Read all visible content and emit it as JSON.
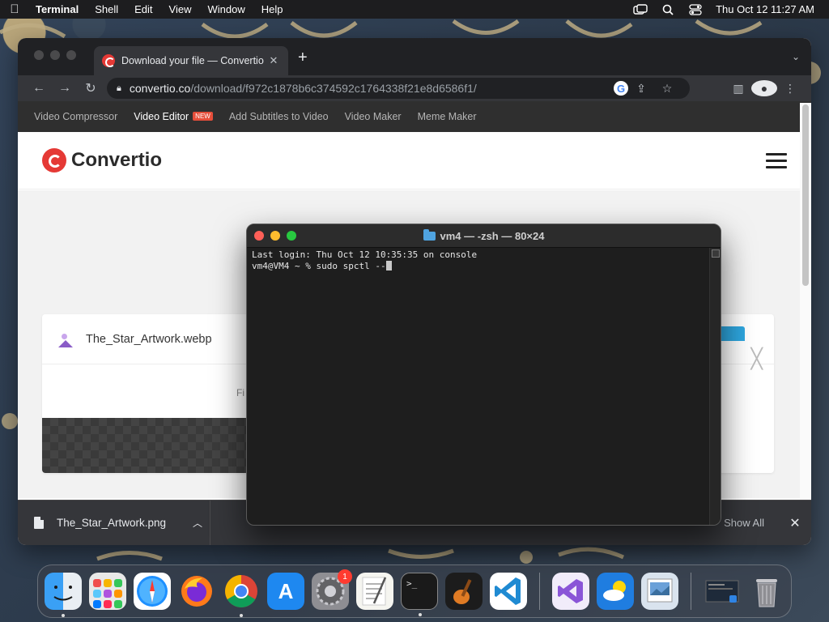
{
  "menubar": {
    "app_name": "Terminal",
    "items": [
      "Shell",
      "Edit",
      "View",
      "Window",
      "Help"
    ],
    "clock": "Thu Oct 12  11:27 AM"
  },
  "browser": {
    "tab_title": "Download your file — Convertio",
    "url_host": "convertio.co",
    "url_path": "/download/f972c1878b6c374592c1764338f21e8d6586f1/",
    "site_nav": {
      "items": [
        "Video Compressor",
        "Video Editor",
        "Add Subtitles to Video",
        "Video Maker",
        "Meme Maker"
      ],
      "badge": "NEW"
    },
    "logo_text": "Convertio",
    "file_name": "The_Star_Artwork.webp",
    "file_sub": "Fi",
    "download_shelf": {
      "file": "The_Star_Artwork.png",
      "show_all": "Show All"
    }
  },
  "terminal": {
    "title": "vm4 — -zsh — 80×24",
    "line1": "Last login: Thu Oct 12 10:35:35 on console",
    "line2": "vm4@VM4 ~ % sudo spctl --"
  },
  "dock": {
    "settings_badge": "1"
  },
  "colors": {
    "menubar": "#1d1d1f",
    "terminal_bg": "#1e1e1e",
    "convertio_red": "#e53935",
    "traffic_red": "#ff5f57",
    "traffic_yellow": "#febc2e",
    "traffic_green": "#28c840"
  }
}
